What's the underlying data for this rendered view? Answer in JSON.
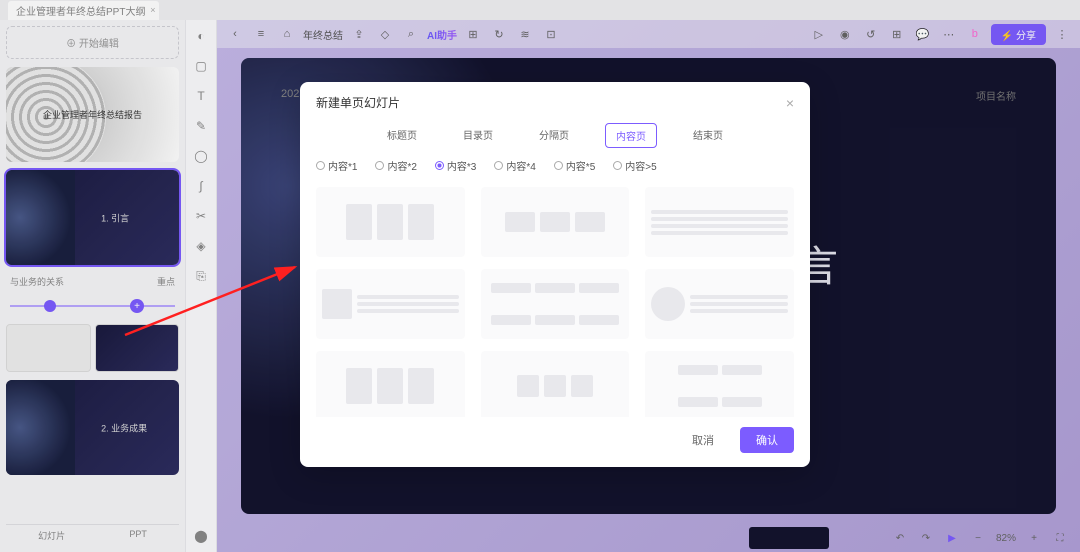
{
  "titlebar": {
    "tab": "企业管理者年终总结PPT大纲"
  },
  "left_panel": {
    "add_button": "⊕ 开始编辑",
    "cover_title": "企业管理者年终总结报告",
    "thumbs": [
      {
        "label": "1. 引言"
      },
      {
        "label": "2. 业务成果"
      }
    ],
    "outline_left": "与业务的关系",
    "outline_right": "重点",
    "footer": {
      "left": "幻灯片",
      "right": "PPT"
    }
  },
  "canvas_toolbar": {
    "back_file": "年终总结",
    "ai": "AI助手",
    "share": "⚡ 分享"
  },
  "canvas_slide": {
    "year": "2023",
    "project": "项目名称",
    "big_text": "言"
  },
  "bottom_bar": {
    "zoom": "82%"
  },
  "modal": {
    "title": "新建单页幻灯片",
    "tabs": [
      "标题页",
      "目录页",
      "分隔页",
      "内容页",
      "结束页"
    ],
    "active_tab_index": 3,
    "radios": [
      "内容*1",
      "内容*2",
      "内容*3",
      "内容*4",
      "内容*5",
      "内容>5"
    ],
    "checked_radio_index": 2,
    "cancel": "取消",
    "confirm": "确认"
  }
}
